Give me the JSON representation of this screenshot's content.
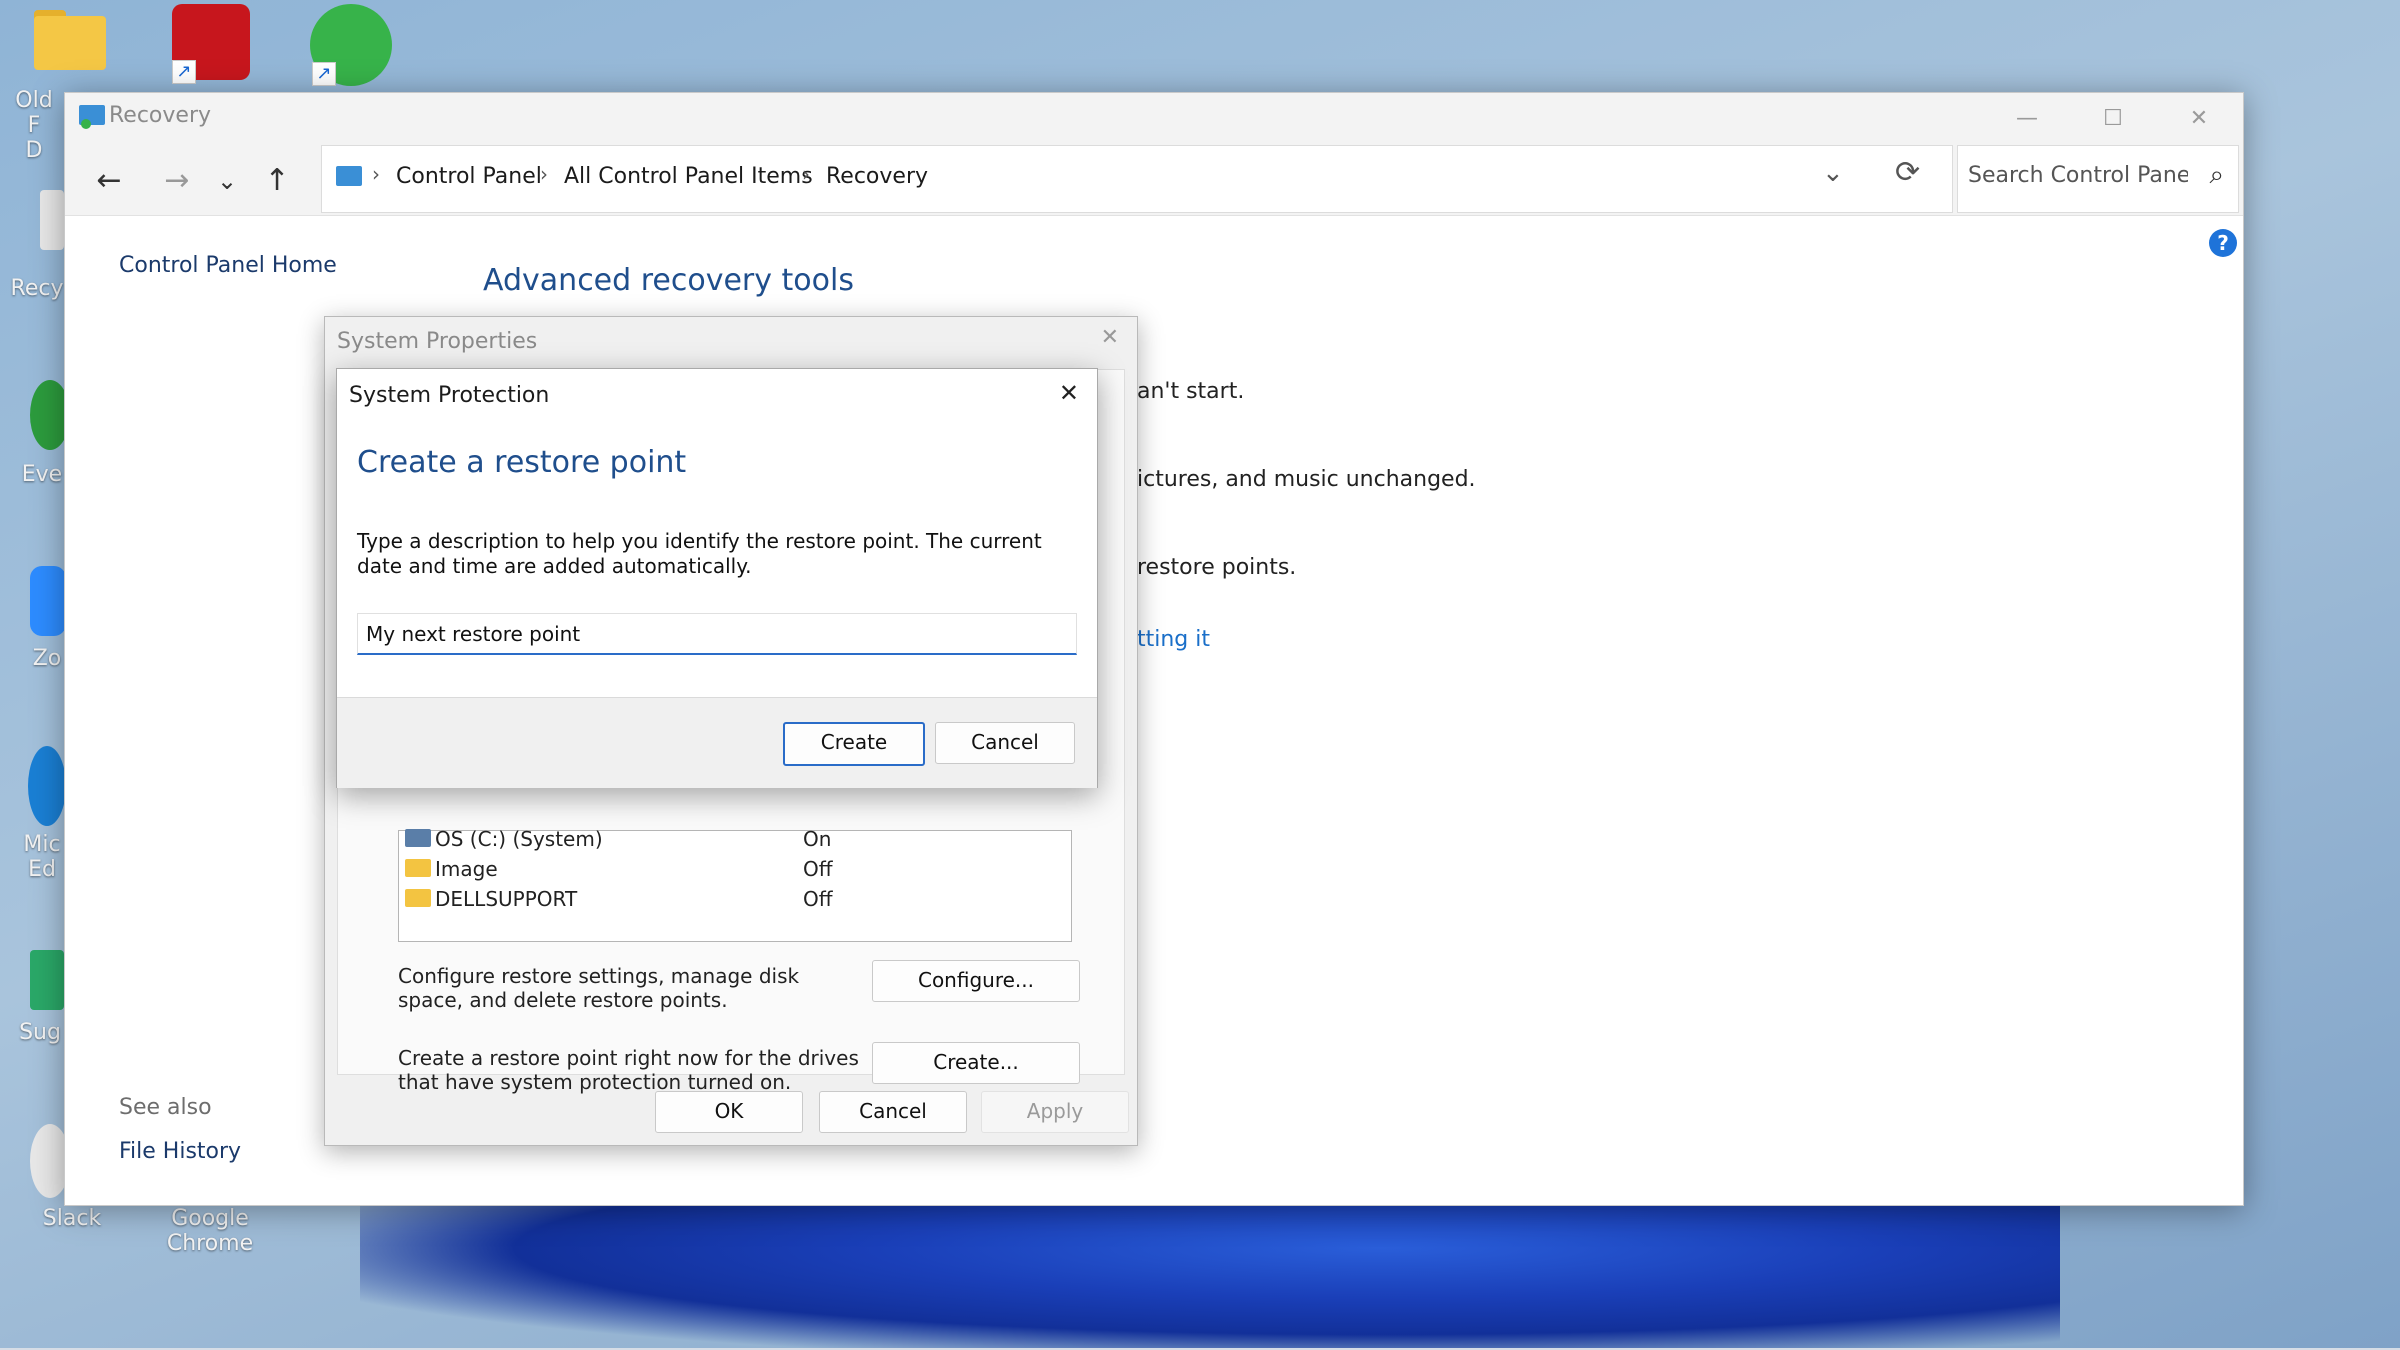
{
  "desktop": {
    "labels": [
      "Old F\nD",
      "Recy",
      "Eve",
      "Zo",
      "Mic\nEd",
      "Sug",
      "Slack",
      "Google\nChrome"
    ]
  },
  "window": {
    "title": "Recovery",
    "minimize": "—",
    "maximize": "☐",
    "close": "✕"
  },
  "nav": {
    "back": "←",
    "forward": "→",
    "recent": "⌄",
    "up": "↑",
    "breadcrumbs": [
      "Control Panel",
      "All Control Panel Items",
      "Recovery"
    ],
    "separator": "›",
    "dropdown": "⌄",
    "refresh": "⟳",
    "search_placeholder": "Search Control Panel",
    "search_icon": "⌕"
  },
  "content": {
    "help": "?",
    "control_panel_home": "Control Panel Home",
    "heading": "Advanced recovery tools",
    "partial_lines": [
      "an't start.",
      "ictures, and music unchanged.",
      "restore points."
    ],
    "partial_link": "tting it",
    "see_also": "See also",
    "file_history": "File History"
  },
  "system_properties": {
    "title": "System Properties",
    "close": "✕",
    "drives": [
      {
        "name": "OS (C:) (System)",
        "status": "On"
      },
      {
        "name": "Image",
        "status": "Off"
      },
      {
        "name": "DELLSUPPORT",
        "status": "Off"
      }
    ],
    "configure_desc": "Configure restore settings, manage disk space, and delete restore points.",
    "configure_button": "Configure...",
    "create_desc": "Create a restore point right now for the drives that have system protection turned on.",
    "create_button": "Create...",
    "ok": "OK",
    "cancel": "Cancel",
    "apply": "Apply"
  },
  "system_protection": {
    "title": "System Protection",
    "close": "✕",
    "heading": "Create a restore point",
    "instructions": "Type a description to help you identify the restore point. The current date and time are added automatically.",
    "input_value": "My next restore point",
    "create": "Create",
    "cancel": "Cancel"
  },
  "colors": {
    "accent": "#2a6cc8",
    "heading_blue": "#1f4e8c",
    "link_blue": "#1a6fc9"
  }
}
